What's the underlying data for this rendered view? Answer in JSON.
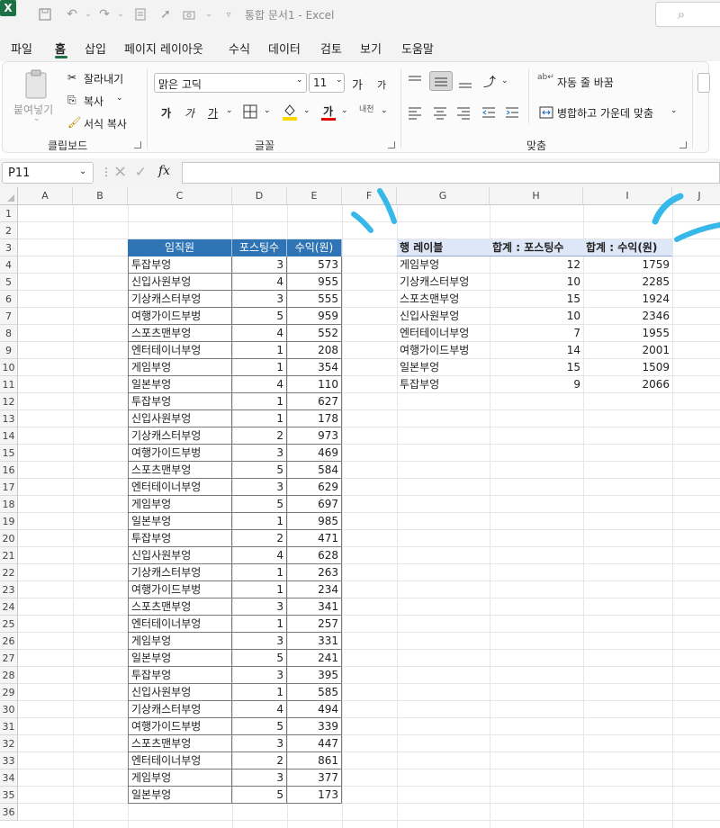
{
  "app": {
    "title": "통합 문서1  -  Excel",
    "logo_letter": "X",
    "accent": "#1d7044"
  },
  "menu": [
    "파일",
    "홈",
    "삽입",
    "페이지 레이아웃",
    "수식",
    "데이터",
    "검토",
    "보기",
    "도움말"
  ],
  "ribbon": {
    "clipboard": {
      "paste": "붙여넣기",
      "cut": "잘라내기",
      "copy": "복사",
      "format_painter": "서식 복사",
      "label": "클립보드"
    },
    "font": {
      "name": "맑은 고딕",
      "size": "11",
      "grow": "가",
      "shrink": "가",
      "bold": "가",
      "italic": "가",
      "underline": "가",
      "color_letter": "가",
      "phonetic": "내천",
      "label": "글꼴"
    },
    "alignment": {
      "wrap_text": "자동 줄 바꿈",
      "merge_center": "병합하고 가운데 맞춤",
      "label": "맞춤"
    }
  },
  "formula_bar": {
    "name_box": "P11",
    "fx": "fx",
    "value": ""
  },
  "columns": [
    "A",
    "B",
    "C",
    "D",
    "E",
    "F",
    "G",
    "H",
    "I",
    "J"
  ],
  "rows": [
    "1",
    "2",
    "3",
    "4",
    "5",
    "6",
    "7",
    "8",
    "9",
    "10",
    "11",
    "12",
    "13",
    "14",
    "15",
    "16",
    "17",
    "18",
    "19",
    "20",
    "21",
    "22",
    "23",
    "24",
    "25",
    "26",
    "27",
    "28",
    "29",
    "30",
    "31",
    "32",
    "33",
    "34",
    "35",
    "36"
  ],
  "table": {
    "headers": [
      "임직원",
      "포스팅수",
      "수익(원)"
    ],
    "rows": [
      [
        "투잡부엉",
        "3",
        "573"
      ],
      [
        "신입사원부엉",
        "4",
        "955"
      ],
      [
        "기상캐스터부엉",
        "3",
        "555"
      ],
      [
        "여행가이드부벙",
        "5",
        "959"
      ],
      [
        "스포츠맨부엉",
        "4",
        "552"
      ],
      [
        "엔터테이너부엉",
        "1",
        "208"
      ],
      [
        "게임부엉",
        "1",
        "354"
      ],
      [
        "일본부엉",
        "4",
        "110"
      ],
      [
        "투잡부엉",
        "1",
        "627"
      ],
      [
        "신입사원부엉",
        "1",
        "178"
      ],
      [
        "기상캐스터부엉",
        "2",
        "973"
      ],
      [
        "여행가이드부벙",
        "3",
        "469"
      ],
      [
        "스포츠맨부엉",
        "5",
        "584"
      ],
      [
        "엔터테이너부엉",
        "3",
        "629"
      ],
      [
        "게임부엉",
        "5",
        "697"
      ],
      [
        "일본부엉",
        "1",
        "985"
      ],
      [
        "투잡부엉",
        "2",
        "471"
      ],
      [
        "신입사원부엉",
        "4",
        "628"
      ],
      [
        "기상캐스터부엉",
        "1",
        "263"
      ],
      [
        "여행가이드부벙",
        "1",
        "234"
      ],
      [
        "스포츠맨부엉",
        "3",
        "341"
      ],
      [
        "엔터테이너부엉",
        "1",
        "257"
      ],
      [
        "게임부엉",
        "3",
        "331"
      ],
      [
        "일본부엉",
        "5",
        "241"
      ],
      [
        "투잡부엉",
        "3",
        "395"
      ],
      [
        "신입사원부엉",
        "1",
        "585"
      ],
      [
        "기상캐스터부엉",
        "4",
        "494"
      ],
      [
        "여행가이드부벙",
        "5",
        "339"
      ],
      [
        "스포츠맨부엉",
        "3",
        "447"
      ],
      [
        "엔터테이너부엉",
        "2",
        "861"
      ],
      [
        "게임부엉",
        "3",
        "377"
      ],
      [
        "일본부엉",
        "5",
        "173"
      ]
    ]
  },
  "pivot": {
    "headers": [
      "행 레이블",
      "합계 : 포스팅수",
      "합계 : 수익(원)"
    ],
    "rows": [
      [
        "게임부엉",
        "12",
        "1759"
      ],
      [
        "기상캐스터부엉",
        "10",
        "2285"
      ],
      [
        "스포츠맨부엉",
        "15",
        "1924"
      ],
      [
        "신입사원부엉",
        "10",
        "2346"
      ],
      [
        "엔터테이너부엉",
        "7",
        "1955"
      ],
      [
        "여행가이드부벙",
        "14",
        "2001"
      ],
      [
        "일본부엉",
        "15",
        "1509"
      ],
      [
        "투잡부엉",
        "9",
        "2066"
      ]
    ]
  },
  "annotation_color": "#36b8e8"
}
